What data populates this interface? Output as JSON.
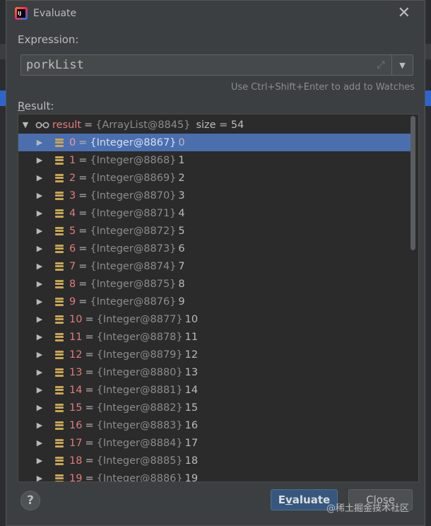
{
  "dialog": {
    "title": "Evaluate",
    "expression_label": "Expression:",
    "expression_value": "porkList",
    "hint": "Use Ctrl+Shift+Enter to add to Watches",
    "result_label_underlined": "R",
    "result_label_rest": "esult:"
  },
  "result": {
    "root_name": "result",
    "root_object": "{ArrayList@8845}",
    "root_size": "size = 54",
    "items": [
      {
        "index": "0",
        "object": "{Integer@8867}",
        "value": "0"
      },
      {
        "index": "1",
        "object": "{Integer@8868}",
        "value": "1"
      },
      {
        "index": "2",
        "object": "{Integer@8869}",
        "value": "2"
      },
      {
        "index": "3",
        "object": "{Integer@8870}",
        "value": "3"
      },
      {
        "index": "4",
        "object": "{Integer@8871}",
        "value": "4"
      },
      {
        "index": "5",
        "object": "{Integer@8872}",
        "value": "5"
      },
      {
        "index": "6",
        "object": "{Integer@8873}",
        "value": "6"
      },
      {
        "index": "7",
        "object": "{Integer@8874}",
        "value": "7"
      },
      {
        "index": "8",
        "object": "{Integer@8875}",
        "value": "8"
      },
      {
        "index": "9",
        "object": "{Integer@8876}",
        "value": "9"
      },
      {
        "index": "10",
        "object": "{Integer@8877}",
        "value": "10"
      },
      {
        "index": "11",
        "object": "{Integer@8878}",
        "value": "11"
      },
      {
        "index": "12",
        "object": "{Integer@8879}",
        "value": "12"
      },
      {
        "index": "13",
        "object": "{Integer@8880}",
        "value": "13"
      },
      {
        "index": "14",
        "object": "{Integer@8881}",
        "value": "14"
      },
      {
        "index": "15",
        "object": "{Integer@8882}",
        "value": "15"
      },
      {
        "index": "16",
        "object": "{Integer@8883}",
        "value": "16"
      },
      {
        "index": "17",
        "object": "{Integer@8884}",
        "value": "17"
      },
      {
        "index": "18",
        "object": "{Integer@8885}",
        "value": "18"
      },
      {
        "index": "19",
        "object": "{Integer@8886}",
        "value": "19"
      }
    ],
    "selected_index": 0
  },
  "buttons": {
    "help": "?",
    "evaluate_underlined": "v",
    "evaluate_pre": "E",
    "evaluate_post": "aluate",
    "close": "Close"
  },
  "watermark": "@稀土掘金技术社区",
  "icons": {
    "app": "intellij-idea-icon",
    "close": "close-icon",
    "expand": "expand-icon",
    "dropdown": "chevron-down-icon",
    "root": "watch-glasses-icon",
    "field": "field-stack-icon",
    "expander": "triangle-right-icon"
  },
  "colors": {
    "selection": "#4b6eaf",
    "name": "#e47a7a",
    "evaluate_button": "#365880"
  }
}
